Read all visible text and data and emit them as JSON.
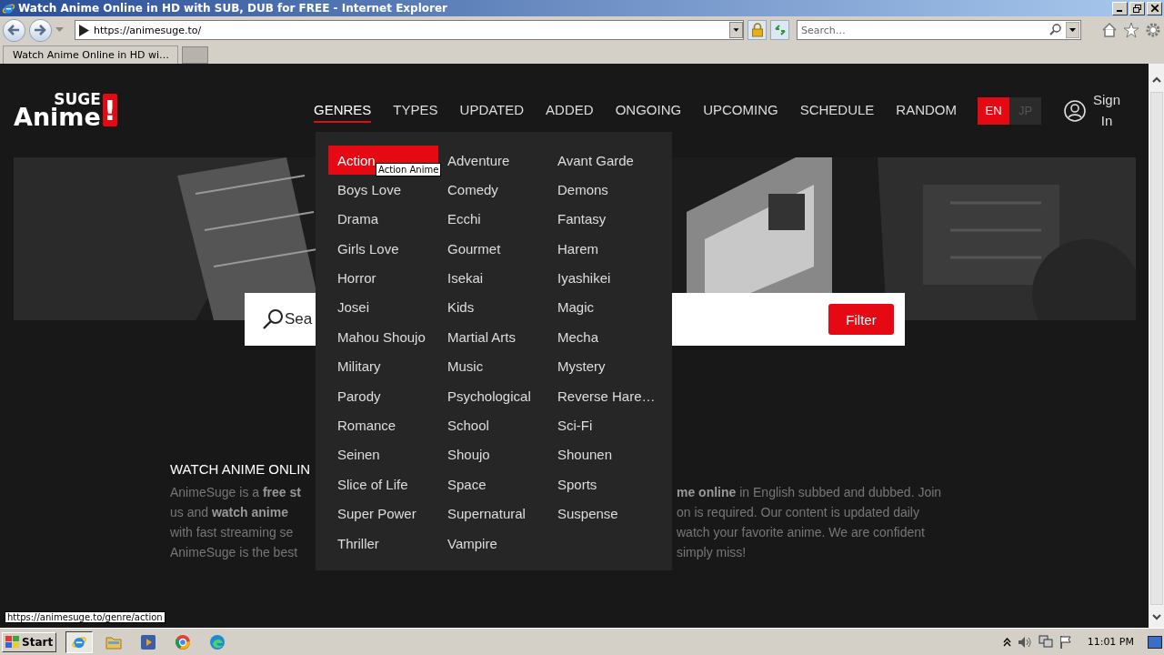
{
  "window": {
    "title": "Watch Anime Online in HD with SUB, DUB for FREE - Internet Explorer"
  },
  "address_bar": {
    "url": "https://animesuge.to/"
  },
  "search_box": {
    "placeholder": "Search…"
  },
  "tabs": [
    {
      "label": "Watch Anime Online in HD wi…",
      "selected": true
    }
  ],
  "site": {
    "logo": {
      "top": "SUGE",
      "bottom": "Anime",
      "mark": "!"
    },
    "nav": [
      {
        "label": "GENRES",
        "selected": true
      },
      {
        "label": "TYPES",
        "selected": false
      },
      {
        "label": "UPDATED",
        "selected": false
      },
      {
        "label": "ADDED",
        "selected": false
      },
      {
        "label": "ONGOING",
        "selected": false
      },
      {
        "label": "UPCOMING",
        "selected": false
      },
      {
        "label": "SCHEDULE",
        "selected": false
      },
      {
        "label": "RANDOM",
        "selected": false
      }
    ],
    "languages": [
      {
        "label": "EN",
        "selected": true
      },
      {
        "label": "JP",
        "selected": false
      }
    ],
    "sign_in": "Sign In",
    "genres_menu": {
      "tooltip": "Action Anime",
      "items": [
        {
          "label": "Action",
          "selected": true
        },
        {
          "label": "Adventure",
          "selected": false
        },
        {
          "label": "Avant Garde",
          "selected": false
        },
        {
          "label": "Boys Love",
          "selected": false
        },
        {
          "label": "Comedy",
          "selected": false
        },
        {
          "label": "Demons",
          "selected": false
        },
        {
          "label": "Drama",
          "selected": false
        },
        {
          "label": "Ecchi",
          "selected": false
        },
        {
          "label": "Fantasy",
          "selected": false
        },
        {
          "label": "Girls Love",
          "selected": false
        },
        {
          "label": "Gourmet",
          "selected": false
        },
        {
          "label": "Harem",
          "selected": false
        },
        {
          "label": "Horror",
          "selected": false
        },
        {
          "label": "Isekai",
          "selected": false
        },
        {
          "label": "Iyashikei",
          "selected": false
        },
        {
          "label": "Josei",
          "selected": false
        },
        {
          "label": "Kids",
          "selected": false
        },
        {
          "label": "Magic",
          "selected": false
        },
        {
          "label": "Mahou Shoujo",
          "selected": false
        },
        {
          "label": "Martial Arts",
          "selected": false
        },
        {
          "label": "Mecha",
          "selected": false
        },
        {
          "label": "Military",
          "selected": false
        },
        {
          "label": "Music",
          "selected": false
        },
        {
          "label": "Mystery",
          "selected": false
        },
        {
          "label": "Parody",
          "selected": false
        },
        {
          "label": "Psychological",
          "selected": false
        },
        {
          "label": "Reverse Hare…",
          "selected": false
        },
        {
          "label": "Romance",
          "selected": false
        },
        {
          "label": "School",
          "selected": false
        },
        {
          "label": "Sci-Fi",
          "selected": false
        },
        {
          "label": "Seinen",
          "selected": false
        },
        {
          "label": "Shoujo",
          "selected": false
        },
        {
          "label": "Shounen",
          "selected": false
        },
        {
          "label": "Slice of Life",
          "selected": false
        },
        {
          "label": "Space",
          "selected": false
        },
        {
          "label": "Sports",
          "selected": false
        },
        {
          "label": "Super Power",
          "selected": false
        },
        {
          "label": "Supernatural",
          "selected": false
        },
        {
          "label": "Suspense",
          "selected": false
        },
        {
          "label": "Thriller",
          "selected": false
        },
        {
          "label": "Vampire",
          "selected": false
        }
      ]
    },
    "search": {
      "placeholder": "Sea",
      "button": "Filter"
    },
    "about": {
      "heading": "WATCH ANIME ONLIN",
      "left_lines": [
        "AnimeSuge is a **free st**",
        "us and **watch anime**",
        "with fast streaming se",
        "AnimeSuge is the best"
      ],
      "right_lines": [
        "**me online** in English subbed and dubbed. Join",
        "on is required. Our content is updated daily",
        "watch your favorite anime. We are confident",
        "simply miss!"
      ]
    }
  },
  "status_text": "https://animesuge.to/genre/action",
  "taskbar": {
    "start": "Start",
    "apps": [
      {
        "kind": "ie",
        "selected": true
      },
      {
        "kind": "folder",
        "selected": false
      },
      {
        "kind": "media",
        "selected": false
      },
      {
        "kind": "chrome",
        "selected": false
      },
      {
        "kind": "edge",
        "selected": false
      }
    ],
    "clock": "11:01 PM"
  }
}
